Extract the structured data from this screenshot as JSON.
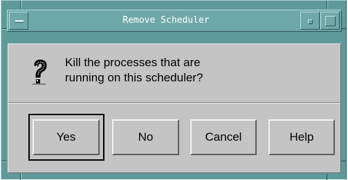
{
  "window": {
    "title": "Remove Scheduler"
  },
  "dialog": {
    "message_line1": "Kill the processes that are",
    "message_line2": "running on this scheduler?",
    "icon": "question-mark-icon"
  },
  "buttons": {
    "yes": "Yes",
    "no": "No",
    "cancel": "Cancel",
    "help": "Help",
    "default": "yes"
  },
  "colors": {
    "frame": "#5f9a9a",
    "titlebar": "#6fa8a8",
    "dialog_background": "#c4c4c4",
    "title_text": "#ffffff"
  }
}
